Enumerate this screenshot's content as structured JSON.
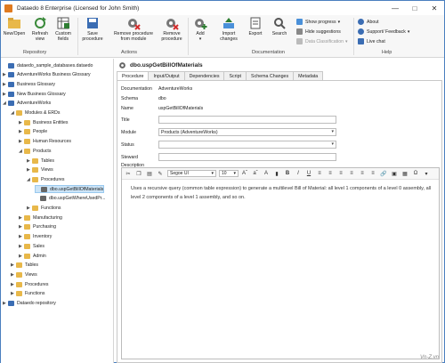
{
  "window": {
    "title": "Dataedo 8 Enterprise (Licensed for John Smith)"
  },
  "ribbon": {
    "groups": {
      "repository": "Repository",
      "actions": "Actions",
      "documentation": "Documentation",
      "help": "Help"
    },
    "buttons": {
      "new_open": "New/Open",
      "refresh": "Refresh view",
      "custom_fields": "Custom fields",
      "save_procedure": "Save procedure",
      "remove_from_module": "Remove procedure from module",
      "remove_procedure": "Remove procedure",
      "add": "Add",
      "import_changes": "Import changes",
      "export": "Export",
      "search": "Search"
    },
    "small": {
      "show_progress": "Show progress",
      "hide_suggestions": "Hide suggestions",
      "data_classification": "Data Classification",
      "about": "About",
      "support": "Support/ Feedback",
      "live_chat": "Live chat"
    }
  },
  "tree": [
    {
      "label": "dataedo_sample_databases.dataedo",
      "level": 0,
      "arrow": ""
    },
    {
      "label": "AdventureWorks Business Glossary",
      "level": 0,
      "arrow": "▶"
    },
    {
      "label": "Business Glossary",
      "level": 0,
      "arrow": "▶"
    },
    {
      "label": "New Business Glossary",
      "level": 0,
      "arrow": "▶"
    },
    {
      "label": "AdventureWorks",
      "level": 0,
      "arrow": "◢"
    },
    {
      "label": "Modules & ERDs",
      "level": 1,
      "arrow": "◢"
    },
    {
      "label": "Business Entities",
      "level": 2,
      "arrow": "▶"
    },
    {
      "label": "People",
      "level": 2,
      "arrow": "▶"
    },
    {
      "label": "Human Resources",
      "level": 2,
      "arrow": "▶"
    },
    {
      "label": "Products",
      "level": 2,
      "arrow": "◢"
    },
    {
      "label": "Tables",
      "level": 3,
      "arrow": "▶"
    },
    {
      "label": "Views",
      "level": 3,
      "arrow": "▶"
    },
    {
      "label": "Procedures",
      "level": 3,
      "arrow": "◢"
    },
    {
      "label": "dbo.uspGetBillOfMaterials",
      "level": 4,
      "arrow": "",
      "selected": true
    },
    {
      "label": "dbo.uspGetWhereUsedPr...",
      "level": 4,
      "arrow": ""
    },
    {
      "label": "Functions",
      "level": 3,
      "arrow": "▶"
    },
    {
      "label": "Manufacturing",
      "level": 2,
      "arrow": "▶"
    },
    {
      "label": "Purchasing",
      "level": 2,
      "arrow": "▶"
    },
    {
      "label": "Inventory",
      "level": 2,
      "arrow": "▶"
    },
    {
      "label": "Sales",
      "level": 2,
      "arrow": "▶"
    },
    {
      "label": "Admin",
      "level": 2,
      "arrow": "▶"
    },
    {
      "label": "Tables",
      "level": 1,
      "arrow": "▶"
    },
    {
      "label": "Views",
      "level": 1,
      "arrow": "▶"
    },
    {
      "label": "Procedures",
      "level": 1,
      "arrow": "▶"
    },
    {
      "label": "Functions",
      "level": 1,
      "arrow": "▶"
    },
    {
      "label": "Dataedo repository",
      "level": 0,
      "arrow": "▶"
    }
  ],
  "main": {
    "object_title": "dbo.uspGetBillOfMaterials",
    "tabs": [
      "Procedure",
      "Input/Output",
      "Dependencies",
      "Script",
      "Schema Changes",
      "Metadata"
    ],
    "fields": {
      "documentation_label": "Documentation",
      "documentation_value": "AdventureWorks",
      "schema_label": "Schema",
      "schema_value": "dbo",
      "name_label": "Name",
      "name_value": "uspGetBillOfMaterials",
      "title_label": "Title",
      "title_value": "",
      "module_label": "Module",
      "module_value": "Products (AdventureWorks)",
      "status_label": "Status",
      "status_value": "",
      "steward_label": "Steward",
      "steward_value": "",
      "description_label": "Description"
    },
    "editor": {
      "font": "Segoe UI",
      "size": "10",
      "text": "Uses a recursive query (common table expression) to generate a multilevel Bill of Material: all level 1 components of a level 0 assembly, all level 2 components of a level 1 assembly, and so on."
    }
  },
  "watermark": "Vn-Z.vn"
}
